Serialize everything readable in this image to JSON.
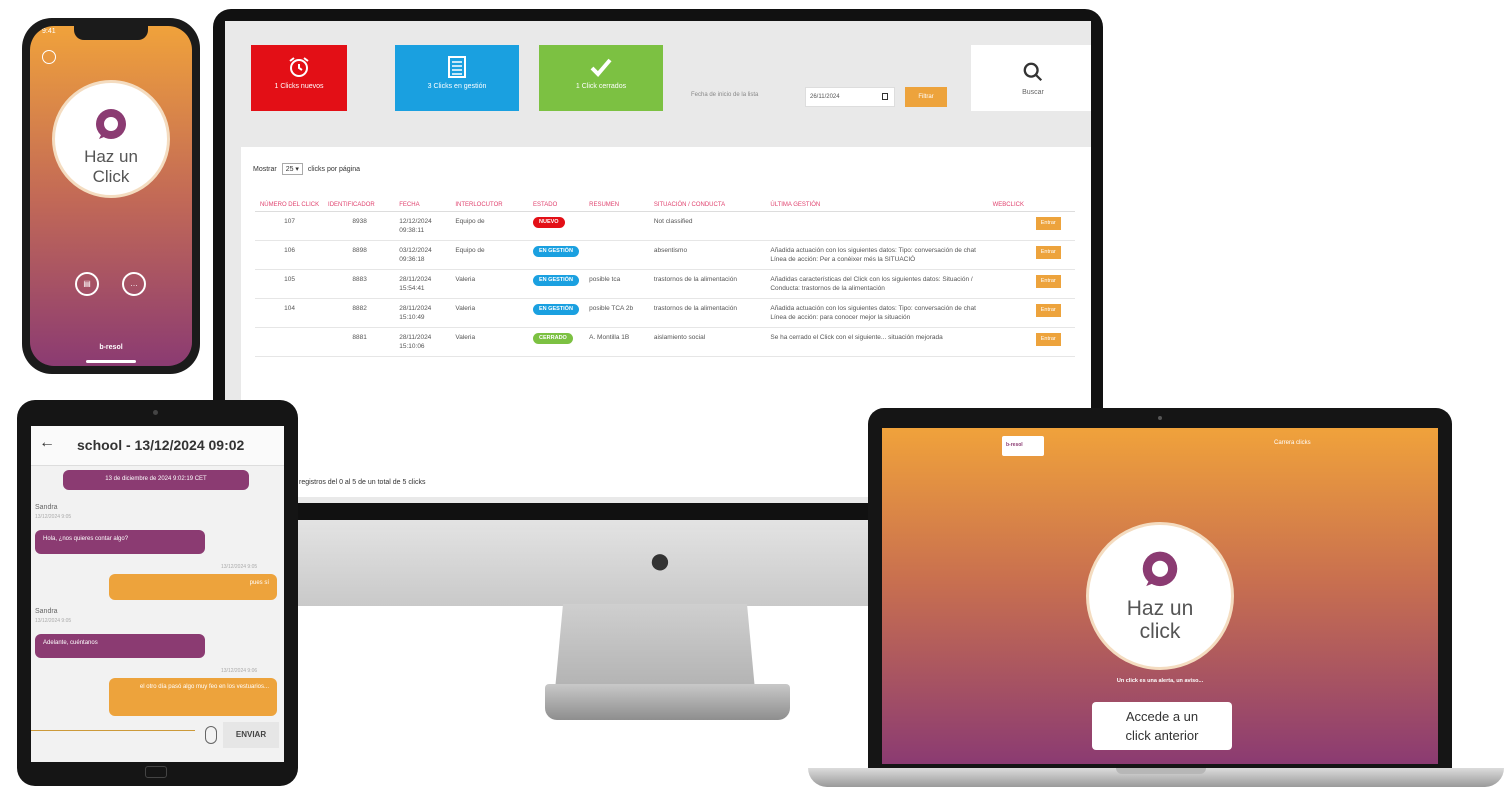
{
  "colors": {
    "new": "#e30f16",
    "in_management": "#1aa0e0",
    "closed": "#7cc142",
    "accent_orange": "#eda33c",
    "brand_purple": "#8b3b72",
    "header_pink": "#e0436f"
  },
  "dashboard": {
    "cards": {
      "new_label": "1 Clicks nuevos",
      "new_icon": "alarm-clock-icon",
      "mgmt_label": "3 Clicks en gestión",
      "mgmt_icon": "list-icon",
      "closed_label": "1 Click cerrados",
      "closed_icon": "checkmark-icon"
    },
    "date_filter": {
      "label": "Fecha de inicio de la lista",
      "value": "26/11/2024",
      "button": "Filtrar"
    },
    "search_label": "Buscar",
    "show": {
      "prefix": "Mostrar",
      "value": "25",
      "suffix": "clicks por página"
    },
    "headers": [
      "NÚMERO DEL CLICK",
      "IDENTIFICADOR",
      "FECHA",
      "INTERLOCUTOR",
      "ESTADO",
      "RESUMEN",
      "SITUACIÓN / CONDUCTA",
      "ÚLTIMA GESTIÓN",
      "WEBCLICK"
    ],
    "rows": [
      {
        "number": "107",
        "id": "8938",
        "date": "12/12/2024 09:38:11",
        "interlocutor": "Equipo de",
        "status": "NUEVO",
        "summary": "",
        "situation": "Not classified",
        "last": "",
        "action": "Entrar"
      },
      {
        "number": "106",
        "id": "8898",
        "date": "03/12/2024 09:36:18",
        "interlocutor": "Equipo de",
        "status": "EN GESTIÓN",
        "summary": "",
        "situation": "absentismo",
        "last": "Añadida actuación con los siguientes datos: Tipo: conversación de chat Línea de acción: Per a conèixer més la SITUACIÓ",
        "action": "Entrar"
      },
      {
        "number": "105",
        "id": "8883",
        "date": "28/11/2024 15:54:41",
        "interlocutor": "Valeria",
        "status": "EN GESTIÓN",
        "summary": "posible tca",
        "situation": "trastornos de la alimentación",
        "last": "Añadidas características del Click con los siguientes datos: Situación / Conducta: trastornos de la alimentación",
        "action": "Entrar"
      },
      {
        "number": "104",
        "id": "8882",
        "date": "28/11/2024 15:10:49",
        "interlocutor": "Valeria",
        "status": "EN GESTIÓN",
        "summary": "posible TCA 2b",
        "situation": "trastornos de la alimentación",
        "last": "Añadida actuación con los siguientes datos: Tipo: conversación de chat Línea de acción: para conocer mejor la situación",
        "action": "Entrar"
      },
      {
        "number": "",
        "id": "8881",
        "date": "28/11/2024 15:10:06",
        "interlocutor": "Valeria",
        "status": "CERRADO",
        "summary": "A. Montilla 1B",
        "situation": "aislamiento social",
        "last": "Se ha cerrado el Click con el siguiente... situación mejorada",
        "action": "Entrar"
      }
    ],
    "records_info": "registros del 0 al 5 de un total de 5 clicks"
  },
  "phone": {
    "time": "9:41",
    "title_line1": "Haz un",
    "title_line2": "Click",
    "brand": "b-resol",
    "icon1": "history-icon",
    "icon2": "chat-icon"
  },
  "tablet": {
    "title": "school - 13/12/2024 09:02",
    "messages": [
      {
        "who": "",
        "text": "13 de diciembre de 2024 9:02:19 CET",
        "side": "left"
      },
      {
        "who": "Sandra",
        "time": "13/12/2024 9:05",
        "text": "Hola, ¿nos quieres contar algo?",
        "side": "left"
      },
      {
        "who": "",
        "time": "13/12/2024 9:05",
        "text": "pues sí",
        "side": "right"
      },
      {
        "who": "Sandra",
        "time": "13/12/2024 9:05",
        "text": "Adelante, cuéntanos",
        "side": "left"
      },
      {
        "who": "",
        "time": "13/12/2024 9:06",
        "text": "el otro día pasó algo muy feo en los vestuarios...",
        "side": "right"
      }
    ],
    "send": "ENVIAR"
  },
  "laptop": {
    "logo": "b-resol",
    "menu": "Carrera clicks",
    "title_line1": "Haz un",
    "title_line2": "click",
    "tagline": "Un click es una alerta, un aviso...",
    "button_line1": "Accede a un",
    "button_line2": "click anterior"
  }
}
